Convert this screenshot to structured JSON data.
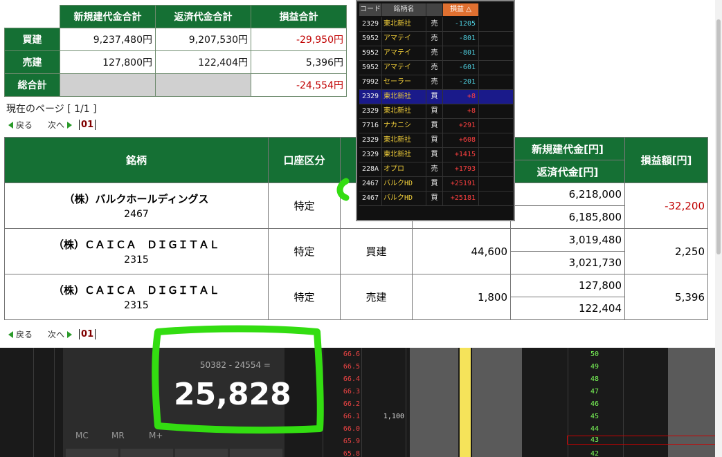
{
  "summary": {
    "headers": [
      "",
      "新規建代金合計",
      "返済代金合計",
      "損益合計"
    ],
    "rows": [
      {
        "label": "買建",
        "new": "9,237,480円",
        "settle": "9,207,530円",
        "pl": "-29,950円"
      },
      {
        "label": "売建",
        "new": "127,800円",
        "settle": "122,404円",
        "pl": "5,396円"
      },
      {
        "label": "総合計",
        "new": "",
        "settle": "",
        "pl": "-24,554円"
      }
    ]
  },
  "paging": {
    "current_page": "現在のページ [ 1/1 ]",
    "prev": "戻る",
    "next": "次へ",
    "page_num": "01"
  },
  "positions": {
    "headers": {
      "name": "銘柄",
      "account": "口座区分",
      "new_amount": "新規建代金[円]",
      "settle_amount": "返済代金[円]",
      "pl": "損益額[円]"
    },
    "rows": [
      {
        "name": "（株）バルクホールディングス",
        "code": "2467",
        "account": "特定",
        "side": "",
        "qty": "",
        "new_amount": "6,218,000",
        "settle_amount": "6,185,800",
        "pl": "-32,200"
      },
      {
        "name": "（株）ＣＡＩＣＡ　ＤＩＧＩＴＡＬ",
        "code": "2315",
        "account": "特定",
        "side": "買建",
        "qty": "44,600",
        "new_amount": "3,019,480",
        "settle_amount": "3,021,730",
        "pl": "2,250"
      },
      {
        "name": "（株）ＣＡＩＣＡ　ＤＩＧＩＴＡＬ",
        "code": "2315",
        "account": "特定",
        "side": "売建",
        "qty": "1,800",
        "new_amount": "127,800",
        "settle_amount": "122,404",
        "pl": "5,396"
      }
    ]
  },
  "overlay": {
    "headers": [
      "コード",
      "銘柄名",
      "",
      "損益 △"
    ],
    "rows": [
      {
        "code": "2329",
        "name": "東北新社",
        "side": "売",
        "pl": "-1205",
        "sign": "neg"
      },
      {
        "code": "5952",
        "name": "アマテイ",
        "side": "売",
        "pl": "-801",
        "sign": "neg"
      },
      {
        "code": "5952",
        "name": "アマテイ",
        "side": "売",
        "pl": "-801",
        "sign": "neg"
      },
      {
        "code": "5952",
        "name": "アマテイ",
        "side": "売",
        "pl": "-601",
        "sign": "neg"
      },
      {
        "code": "7992",
        "name": "セーラー",
        "side": "売",
        "pl": "-201",
        "sign": "neg"
      },
      {
        "code": "2329",
        "name": "東北新社",
        "side": "買",
        "pl": "+8",
        "sign": "pos",
        "selected": true
      },
      {
        "code": "2329",
        "name": "東北新社",
        "side": "買",
        "pl": "+8",
        "sign": "pos"
      },
      {
        "code": "7716",
        "name": "ナカニシ",
        "side": "買",
        "pl": "+291",
        "sign": "pos"
      },
      {
        "code": "2329",
        "name": "東北新社",
        "side": "買",
        "pl": "+608",
        "sign": "pos"
      },
      {
        "code": "2329",
        "name": "東北新社",
        "side": "買",
        "pl": "+1415",
        "sign": "pos"
      },
      {
        "code": "228A",
        "name": "オプロ",
        "side": "売",
        "pl": "+1793",
        "sign": "pos"
      },
      {
        "code": "2467",
        "name": "バルクHD",
        "side": "買",
        "pl": "+25191",
        "sign": "pos"
      },
      {
        "code": "2467",
        "name": "バルクHD",
        "side": "買",
        "pl": "+25181",
        "sign": "pos"
      }
    ]
  },
  "calculator": {
    "expression": "50382 - 24554 =",
    "result": "25,828",
    "mem_buttons": [
      "MC",
      "MR",
      "M+"
    ]
  },
  "board": {
    "prices": [
      "66.6",
      "66.5",
      "66.4",
      "66.3",
      "66.2",
      "66.1",
      "66.0",
      "65.9",
      "65.8"
    ],
    "qty_at": "1,100",
    "ladder": [
      "50",
      "49",
      "48",
      "47",
      "46",
      "45",
      "44",
      "43",
      "42"
    ]
  },
  "colors": {
    "header_green": "#157034",
    "negative_red": "#c00000",
    "annotation_green": "#33dd11"
  }
}
